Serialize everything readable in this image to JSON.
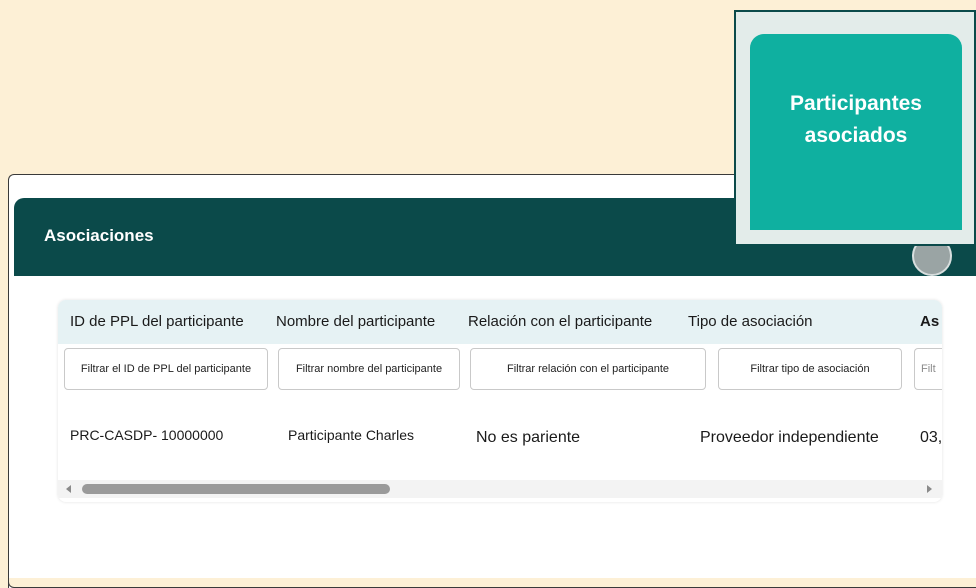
{
  "section": {
    "title": "Asociaciones"
  },
  "callout": {
    "line1": "Participantes",
    "line2": "asociados"
  },
  "table": {
    "headers": [
      "ID de PPL del participante",
      "Nombre del participante",
      "Relación con el participante",
      "Tipo de asociación",
      "As"
    ],
    "filters": [
      "Filtrar el ID de PPL del participante",
      "Filtrar nombre del participante",
      "Filtrar relación con el participante",
      "Filtrar tipo de asociación",
      "Filt"
    ],
    "rows": [
      {
        "id": "PRC-CASDP- 10000000",
        "name": "Participante Charles",
        "relation": "No es pariente",
        "type": "Proveedor independiente",
        "date": "03,"
      }
    ]
  },
  "colors": {
    "page_bg": "#fdf0d6",
    "banner": "#0b4a4a",
    "tile": "#0fb0a0",
    "header_row": "#e6f2f4"
  },
  "icons": [
    "scroll-left-icon",
    "scroll-right-icon"
  ]
}
